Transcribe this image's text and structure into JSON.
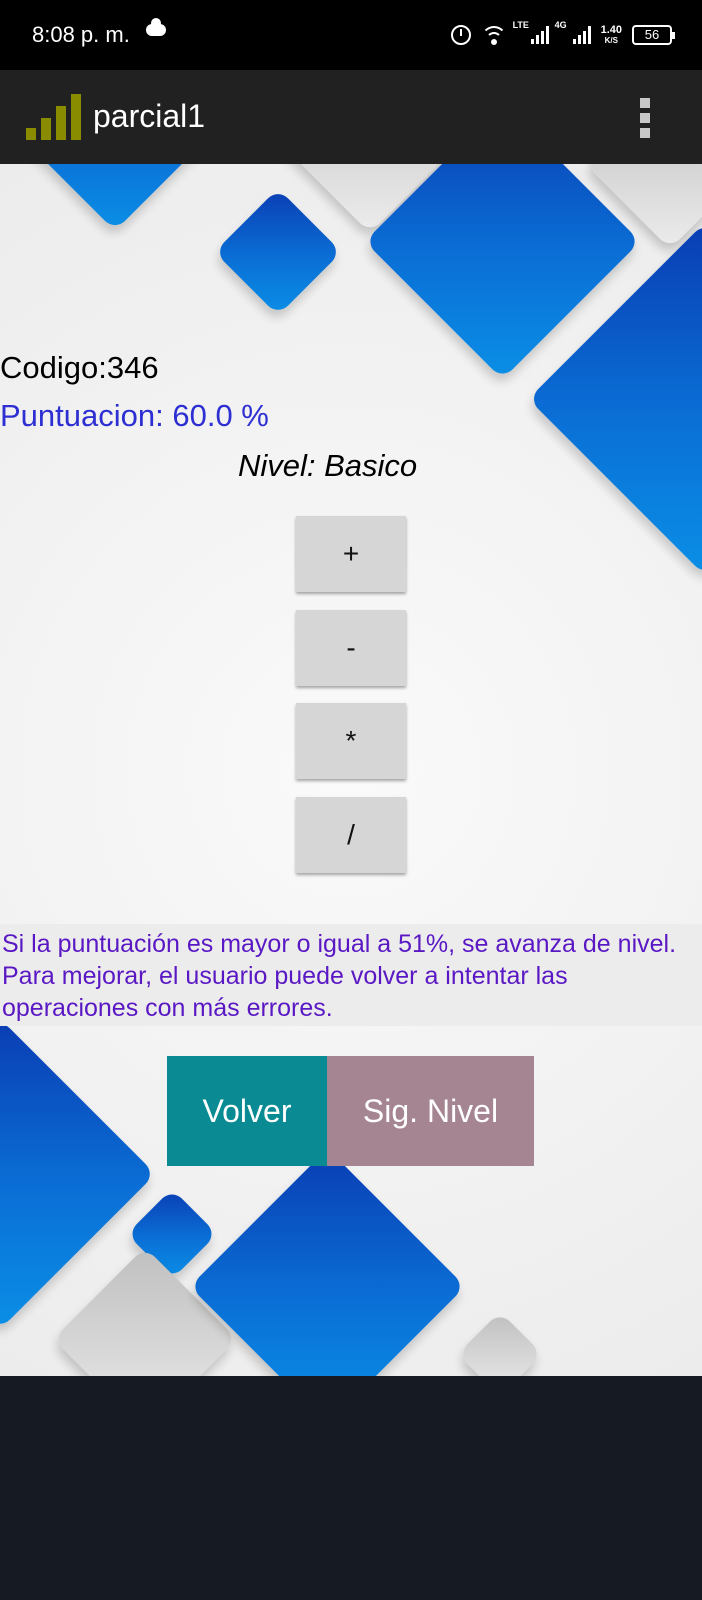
{
  "status_bar": {
    "time": "8:08 p. m.",
    "weather_icon": "cloud-icon",
    "network_1": "LTE",
    "network_2": "4G",
    "speed_value": "1.40",
    "speed_unit": "K/S",
    "battery": "56"
  },
  "app_bar": {
    "title": "parcial1",
    "icon": "signal-bars-icon",
    "menu_icon": "overflow-menu-icon",
    "icon_color": "#8a8c00"
  },
  "result": {
    "codigo": "Codigo:346",
    "puntuacion": "Puntuacion: 60.0 %",
    "nivel": "Nivel: Basico"
  },
  "operations": {
    "add": "+",
    "subtract": "-",
    "multiply": "*",
    "divide": "/"
  },
  "info": {
    "text": "Si la puntuación es mayor o igual a 51%, se avanza de nivel. Para mejorar, el usuario puede volver a intentar las operaciones con más errores."
  },
  "actions": {
    "volver": "Volver",
    "siguiente": "Sig. Nivel"
  },
  "colors": {
    "puntuacion_text": "#2d2fd3",
    "info_text": "#5a18c4",
    "volver_bg": "#0a8a92",
    "siguiente_bg": "#a48591",
    "decor_blue": "#0a6fd6"
  }
}
